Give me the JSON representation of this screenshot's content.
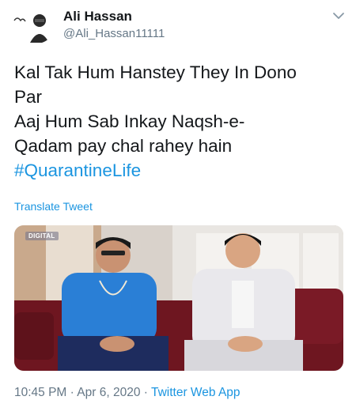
{
  "user": {
    "name": "Ali Hassan",
    "handle": "@Ali_Hassan11111"
  },
  "tweet": {
    "lines": [
      "Kal Tak Hum Hanstey They In Dono",
      "Par",
      "Aaj Hum Sab Inkay Naqsh-e-",
      "Qadam pay chal rahey hain"
    ],
    "hashtag": "#QuarantineLife",
    "translate_label": "Translate Tweet"
  },
  "media": {
    "channel_logo": "DIGITAL"
  },
  "footer": {
    "time": "10:45 PM",
    "separator": "·",
    "date": "Apr 6, 2020",
    "source": "Twitter Web App"
  },
  "colors": {
    "link": "#1b95e0",
    "secondary_text": "#657786",
    "primary_text": "#14171a"
  },
  "icons": {
    "caret": "chevron-down-icon",
    "avatar": "avatar"
  }
}
